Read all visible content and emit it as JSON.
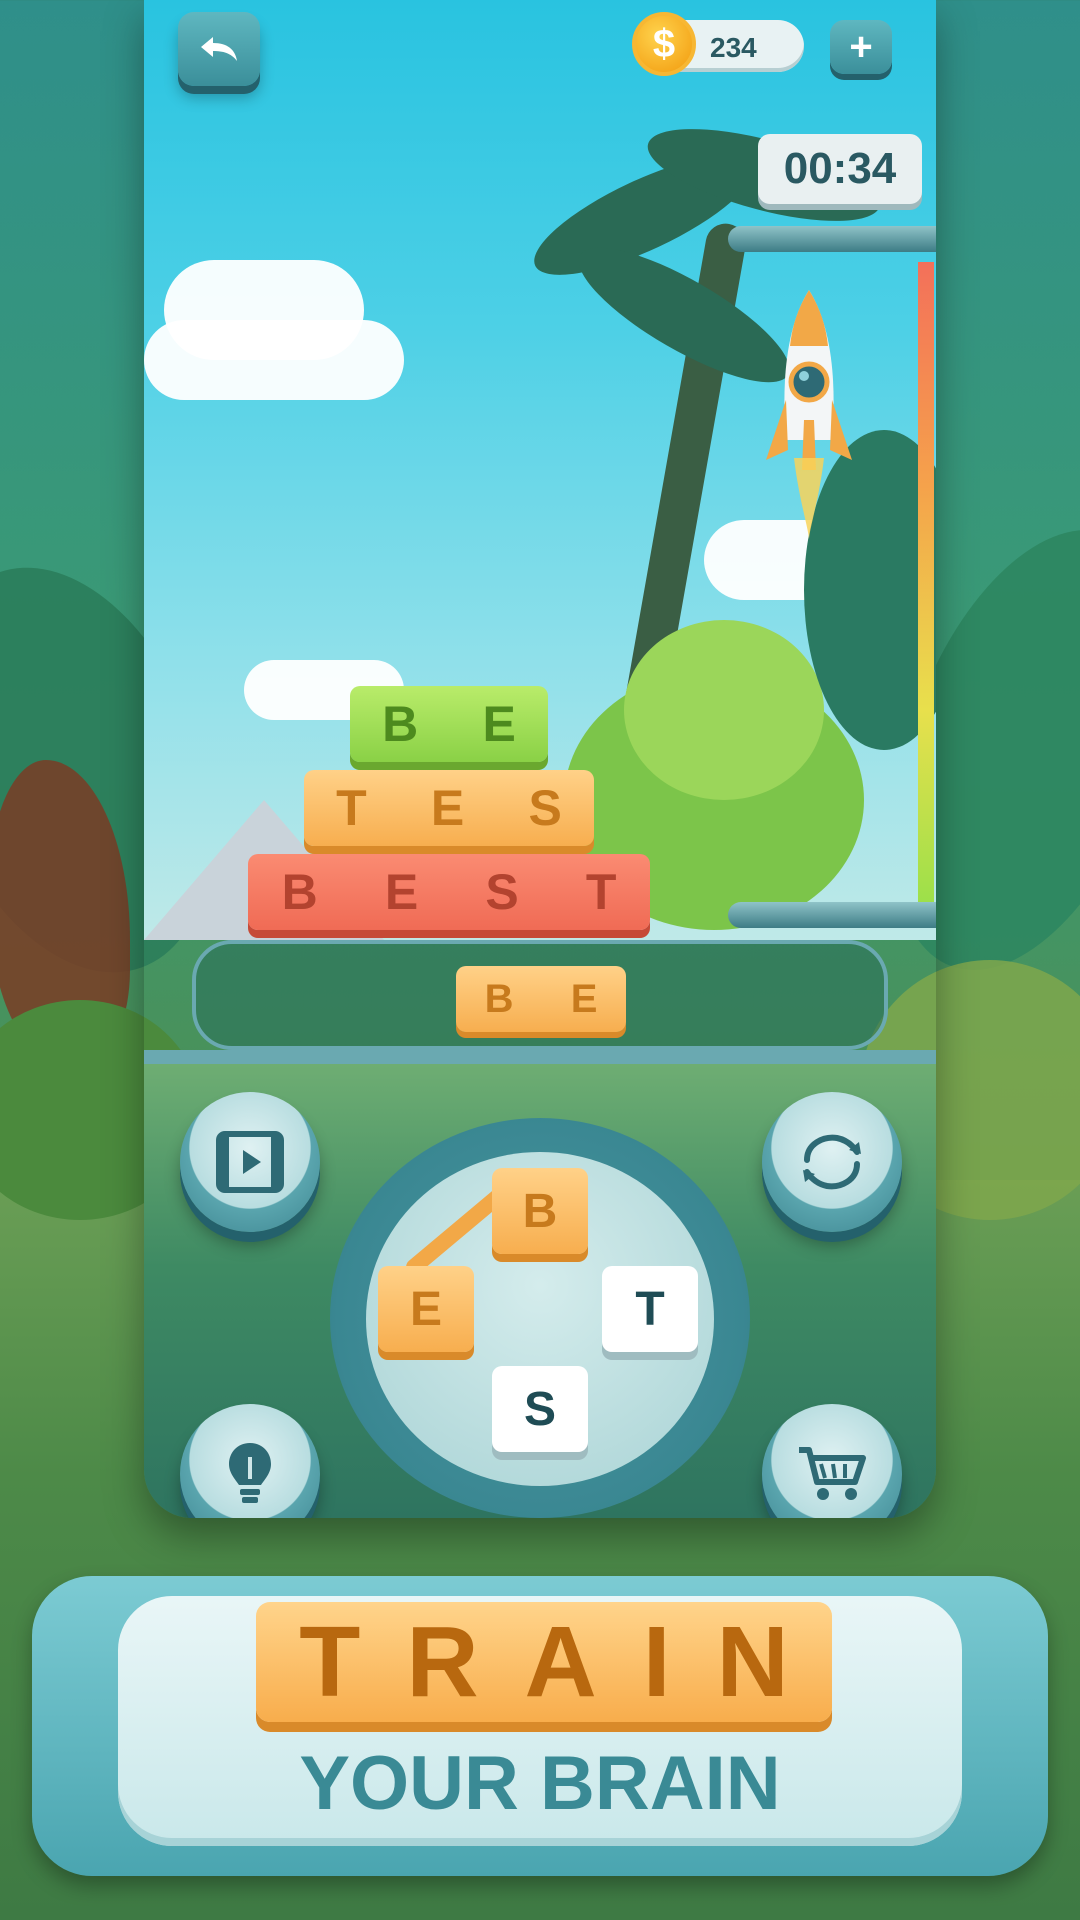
{
  "top_bar": {
    "back_icon": "back-arrow-icon",
    "coins": "234",
    "coin_symbol": "$",
    "add_label": "+"
  },
  "timer": "00:34",
  "progress_colors": [
    "#f3705a",
    "#f5a24b",
    "#e8e04c",
    "#9de04a"
  ],
  "word_stack": [
    {
      "letters": [
        "B",
        "E"
      ],
      "color": "#8ad146"
    },
    {
      "letters": [
        "T",
        "E",
        "S"
      ],
      "color": "#f7ae4f"
    },
    {
      "letters": [
        "B",
        "E",
        "S",
        "T"
      ],
      "color": "#f06b55"
    }
  ],
  "current_word": [
    "B",
    "E"
  ],
  "wheel": {
    "letters": [
      "B",
      "E",
      "T",
      "S"
    ],
    "selected": [
      "B",
      "E"
    ]
  },
  "buttons": {
    "video_icon": "video-icon",
    "shuffle_icon": "shuffle-icon",
    "hint_icon": "lightbulb-icon",
    "shop_icon": "cart-icon"
  },
  "banner": {
    "headline": "TRAIN",
    "subline": "YOUR BRAIN"
  }
}
